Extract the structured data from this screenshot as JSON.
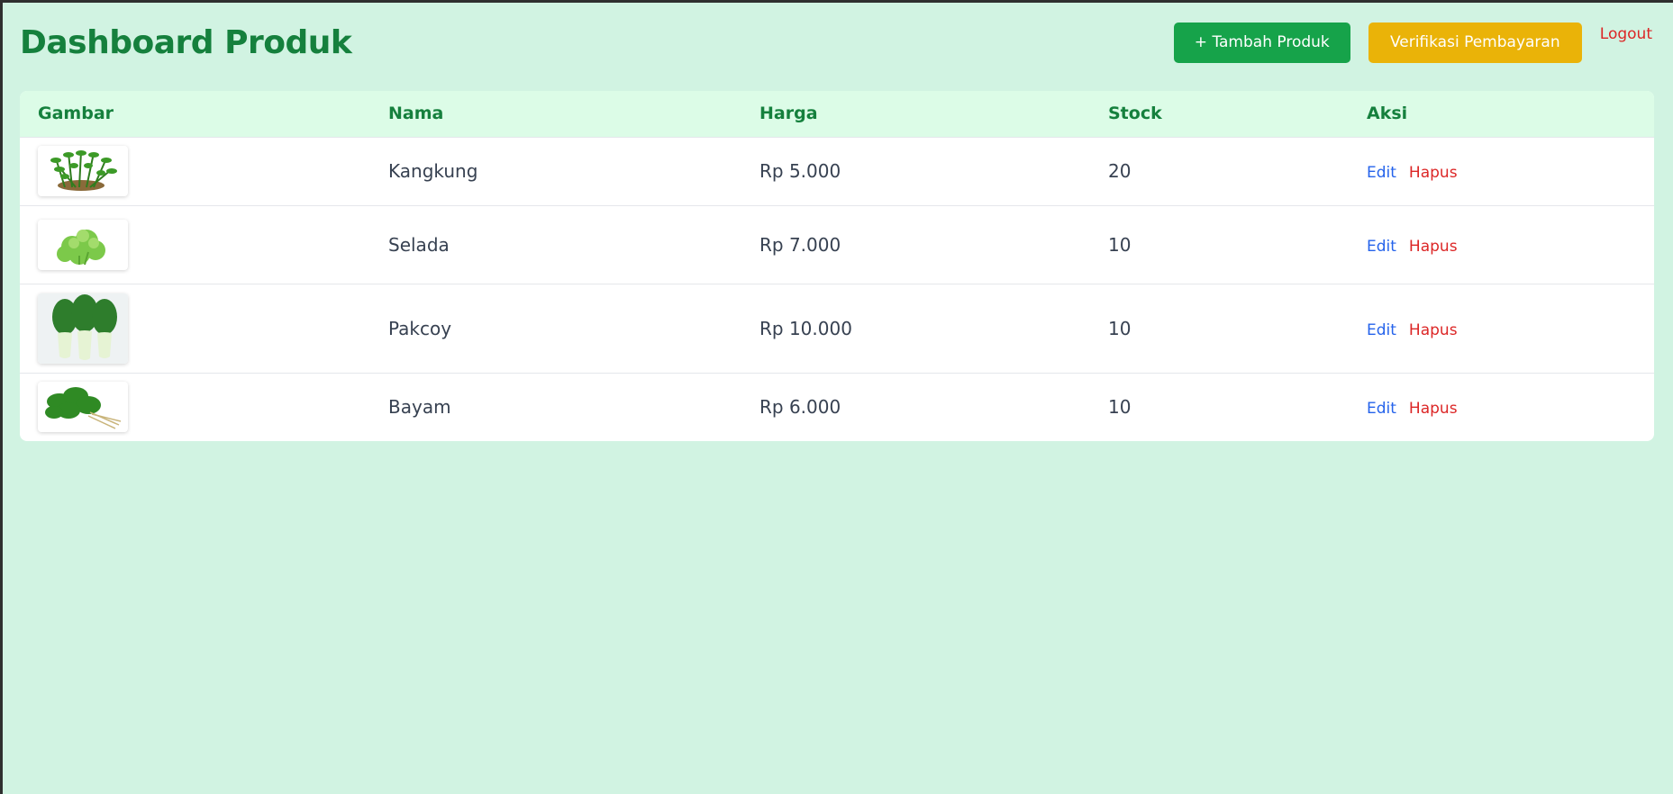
{
  "header": {
    "title": "Dashboard Produk",
    "add_label": "+ Tambah Produk",
    "verify_label": "Verifikasi Pembayaran",
    "logout_label": "Logout"
  },
  "table": {
    "columns": [
      "Gambar",
      "Nama",
      "Harga",
      "Stock",
      "Aksi"
    ],
    "rows": [
      {
        "name": "Kangkung",
        "price": "Rp 5.000",
        "stock": "20",
        "edit": "Edit",
        "delete": "Hapus"
      },
      {
        "name": "Selada",
        "price": "Rp 7.000",
        "stock": "10",
        "edit": "Edit",
        "delete": "Hapus"
      },
      {
        "name": "Pakcoy",
        "price": "Rp 10.000",
        "stock": "10",
        "edit": "Edit",
        "delete": "Hapus"
      },
      {
        "name": "Bayam",
        "price": "Rp 6.000",
        "stock": "10",
        "edit": "Edit",
        "delete": "Hapus"
      }
    ]
  },
  "colors": {
    "background": "#d1f3e2",
    "accent_green": "#16a34a",
    "title_green": "#15803d",
    "warning_yellow": "#eab308",
    "danger_red": "#dc2626",
    "link_blue": "#2563eb"
  }
}
